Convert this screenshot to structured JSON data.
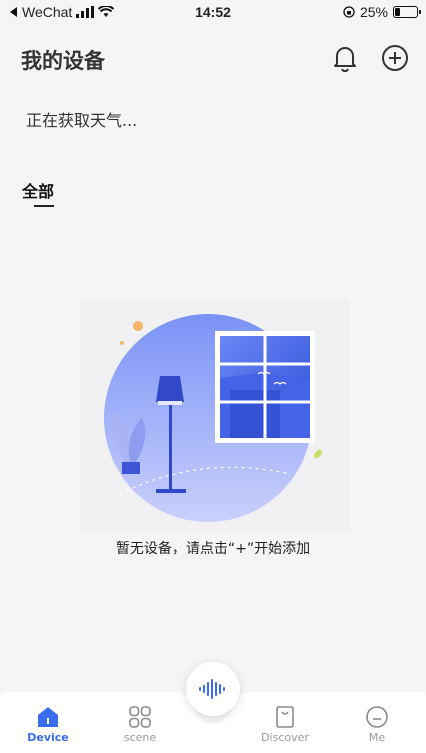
{
  "status_bar": {
    "back_app": "WeChat",
    "time": "14:52",
    "battery": "25%",
    "battery_level": 0.25
  },
  "header": {
    "title": "我的设备",
    "icons": [
      "bell-icon",
      "add-circle-icon"
    ]
  },
  "weather": {
    "text": "正在获取天气..."
  },
  "tabs": {
    "active_label": "全部"
  },
  "empty_state": {
    "message": "暂无设备，请点击“+”开始添加"
  },
  "bottom_nav": {
    "items": [
      {
        "label": "Device",
        "icon": "home-icon",
        "active": true
      },
      {
        "label": "scene",
        "icon": "grid-icon",
        "active": false
      },
      {
        "label": "Discover",
        "icon": "bag-icon",
        "active": false
      },
      {
        "label": "Me",
        "icon": "face-icon",
        "active": false
      }
    ],
    "voice_icon": "voice-wave-icon"
  },
  "colors": {
    "accent": "#3a6cf0",
    "inactive": "#9a9a9a",
    "background": "#f5f5f6"
  }
}
